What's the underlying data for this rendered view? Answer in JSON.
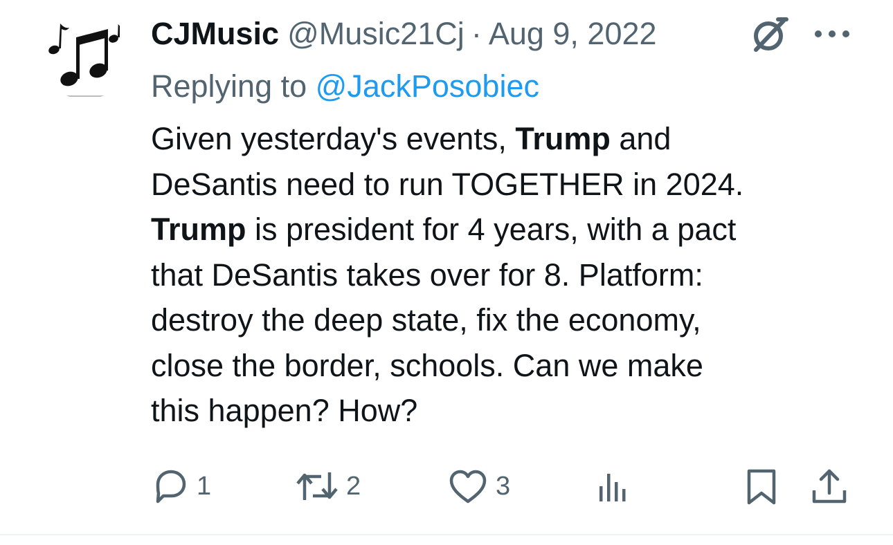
{
  "tweet": {
    "display_name": "CJMusic",
    "handle": "@Music21Cj",
    "separator": "·",
    "date": "Aug 9, 2022",
    "replying_prefix": "Replying to",
    "replying_handle": "@JackPosobiec",
    "body_lines": [
      [
        {
          "t": "Given yesterday's events, "
        },
        {
          "t": "Trump",
          "b": true
        },
        {
          "t": " and"
        }
      ],
      [
        {
          "t": "DeSantis need to run TOGETHER in 2024."
        }
      ],
      [
        {
          "t": "Trump",
          "b": true
        },
        {
          "t": " is president for 4 years, with a pact"
        }
      ],
      [
        {
          "t": "that DeSantis takes over for 8. Platform:"
        }
      ],
      [
        {
          "t": "destroy the deep state, fix the economy,"
        }
      ],
      [
        {
          "t": "close the border, schools. Can we make"
        }
      ],
      [
        {
          "t": "this happen? How?"
        }
      ]
    ]
  },
  "actions": {
    "reply_count": "1",
    "retweet_count": "2",
    "like_count": "3"
  },
  "icons": {
    "avatar": "music-notes-icon",
    "grok": "grok-icon",
    "more": "more-dots-icon",
    "reply": "reply-bubble-icon",
    "retweet": "retweet-icon",
    "like": "heart-icon",
    "views": "analytics-bars-icon",
    "bookmark": "bookmark-icon",
    "share": "share-upload-icon"
  },
  "colors": {
    "text": "#0f1419",
    "secondary": "#536471",
    "accent": "#1d9bf0"
  }
}
